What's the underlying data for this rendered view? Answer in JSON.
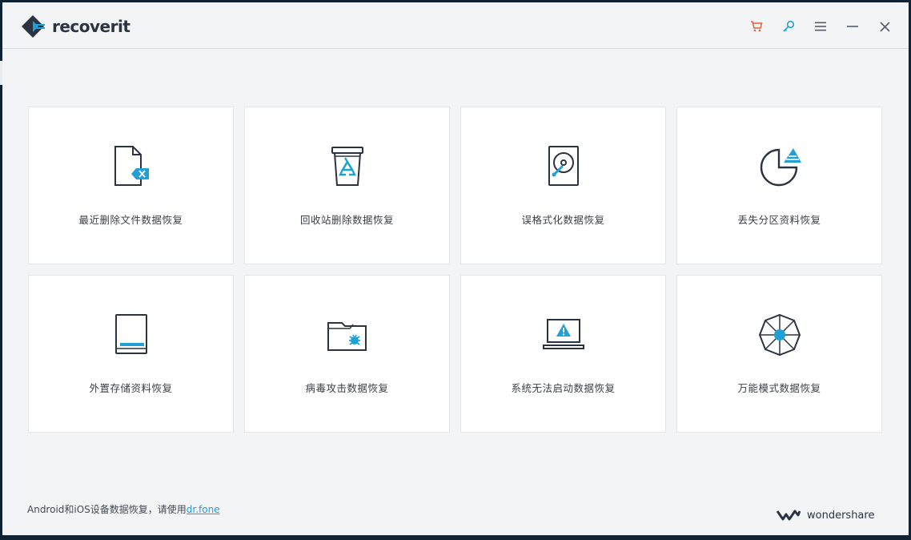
{
  "app": {
    "logo_text": "recoverit",
    "brand_text": "wondershare"
  },
  "titlebar": {
    "controls": [
      {
        "name": "cart-icon",
        "color": "#e4603b"
      },
      {
        "name": "key-icon",
        "color": "#1fa1d5"
      },
      {
        "name": "menu-icon",
        "color": "#555c66"
      },
      {
        "name": "minimize-icon",
        "color": "#555c66"
      },
      {
        "name": "close-icon",
        "color": "#555c66"
      }
    ]
  },
  "cards": [
    {
      "label": "最近删除文件数据恢复",
      "icon": "deleted-file-icon"
    },
    {
      "label": "回收站删除数据恢复",
      "icon": "recycle-bin-icon"
    },
    {
      "label": "误格式化数据恢复",
      "icon": "formatted-disk-icon"
    },
    {
      "label": "丢失分区资料恢复",
      "icon": "lost-partition-icon"
    },
    {
      "label": "外置存储资料恢复",
      "icon": "external-storage-icon"
    },
    {
      "label": "病毒攻击数据恢复",
      "icon": "virus-folder-icon"
    },
    {
      "label": "系统无法启动数据恢复",
      "icon": "crashed-computer-icon"
    },
    {
      "label": "万能模式数据恢复",
      "icon": "all-around-icon"
    }
  ],
  "footer": {
    "note_prefix": "Android和iOS设备数据恢复，请使用",
    "link_text": "dr.fone"
  },
  "colors": {
    "accent": "#1fa1d5",
    "icon_stroke": "#2b3340",
    "background": "#f3f4f6"
  }
}
